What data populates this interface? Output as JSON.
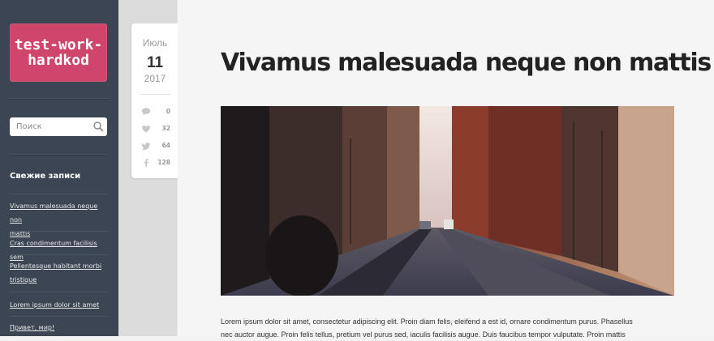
{
  "site": {
    "logo_line1": "test-work-",
    "logo_line2": "hardkod"
  },
  "search": {
    "placeholder": "Поиск"
  },
  "recent": {
    "title": "Свежие записи",
    "items": [
      {
        "line1": "Vivamus malesuada neque non",
        "line2": "mattis"
      },
      {
        "line1": "Cras condimentum facilisis sem",
        "line2": ""
      },
      {
        "line1": "Pellentesque habitant morbi",
        "line2": "tristique"
      },
      {
        "line1": "Lorem ipsum dolor sit amet",
        "line2": ""
      },
      {
        "line1": "Привет, мир!",
        "line2": ""
      }
    ]
  },
  "date": {
    "month": "Июль",
    "day": "11",
    "year": "2017"
  },
  "stats": {
    "comments": "0",
    "likes": "32",
    "twitter": "64",
    "facebook": "128"
  },
  "post": {
    "title": "Vivamus malesuada neque non mattis",
    "body_line1": "Lorem ipsum dolor sit amet, consectetur adipiscing elit. Proin diam felis, eleifend a est id, ornare condimentum purus. Phasellus",
    "body_line2": "nec auctor augue. Proin felis tellus, pretium vel purus sed, iaculis facilisis augue. Duis faucibus tempor vulputate. Proin mattis"
  },
  "colors": {
    "sidebar": "#3b4554",
    "logo": "#d0466a",
    "page": "#f3f3f3"
  }
}
